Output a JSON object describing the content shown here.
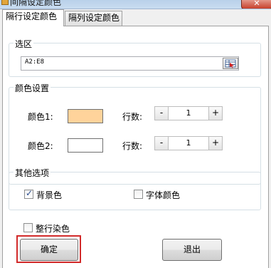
{
  "window": {
    "title": "间隔设定颜色",
    "close_glyph": "✕"
  },
  "tabs": [
    {
      "label": "隔行设定颜色",
      "active": true
    },
    {
      "label": "隔列设定颜色",
      "active": false
    }
  ],
  "range_group": {
    "legend": "选区",
    "value": "A2:E8"
  },
  "color_group": {
    "legend": "颜色设置",
    "rows": [
      {
        "label": "颜色1:",
        "color": "#ffd39b",
        "count_label": "行数:",
        "value": "1",
        "minus": "-",
        "plus": "+"
      },
      {
        "label": "颜色2:",
        "color": "#ffffff",
        "count_label": "行数:",
        "value": "1",
        "minus": "-",
        "plus": "+"
      }
    ]
  },
  "other_group": {
    "legend": "其他选项",
    "background": {
      "label": "背景色",
      "checked": true
    },
    "font_color": {
      "label": "字体颜色",
      "checked": false
    }
  },
  "whole_row": {
    "label": "整行染色",
    "checked": false
  },
  "buttons": {
    "ok": "确定",
    "exit": "退出"
  },
  "colors": {
    "focus": "#d22a2a",
    "swatch1": "#ffd39b"
  }
}
